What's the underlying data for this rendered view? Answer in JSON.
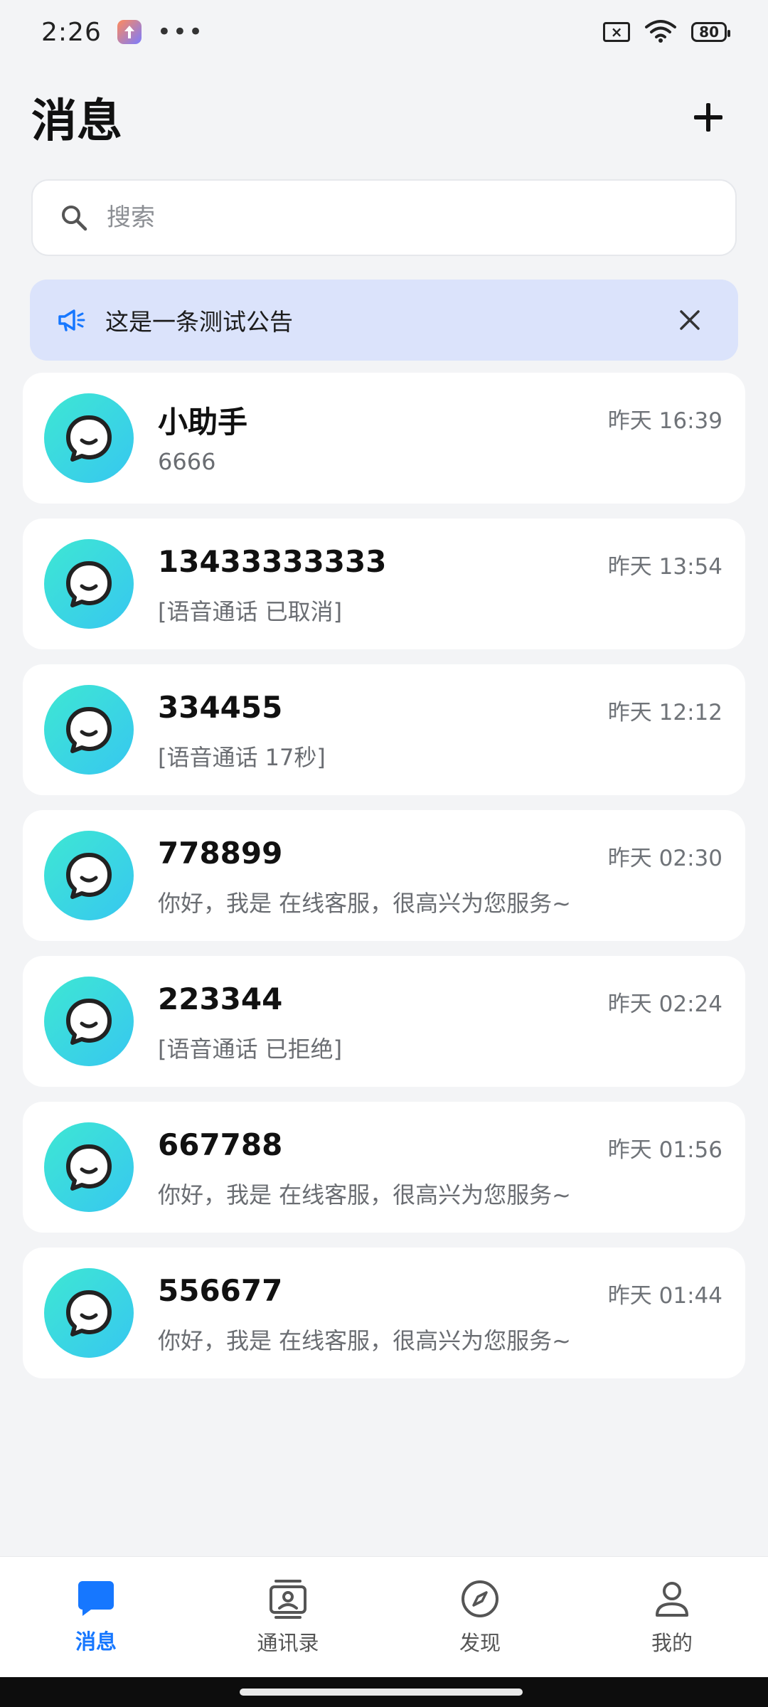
{
  "status_bar": {
    "time": "2:26",
    "battery": "80"
  },
  "header": {
    "title": "消息"
  },
  "search": {
    "placeholder": "搜索"
  },
  "notice": {
    "text": "这是一条测试公告"
  },
  "conversations": [
    {
      "name": "小助手",
      "time": "昨天 16:39",
      "preview": "6666"
    },
    {
      "name": "13433333333",
      "time": "昨天 13:54",
      "preview": "[语音通话 已取消]"
    },
    {
      "name": "334455",
      "time": "昨天 12:12",
      "preview": "[语音通话 17秒]"
    },
    {
      "name": "778899",
      "time": "昨天 02:30",
      "preview": "你好，我是 在线客服，很高兴为您服务~"
    },
    {
      "name": "223344",
      "time": "昨天 02:24",
      "preview": "[语音通话 已拒绝]"
    },
    {
      "name": "667788",
      "time": "昨天 01:56",
      "preview": "你好，我是 在线客服，很高兴为您服务~"
    },
    {
      "name": "556677",
      "time": "昨天 01:44",
      "preview": "你好，我是 在线客服，很高兴为您服务~"
    }
  ],
  "tabbar": {
    "tabs": [
      {
        "label": "消息",
        "icon": "chat-bubble-icon",
        "active": true
      },
      {
        "label": "通讯录",
        "icon": "contacts-icon",
        "active": false
      },
      {
        "label": "发现",
        "icon": "compass-icon",
        "active": false
      },
      {
        "label": "我的",
        "icon": "person-icon",
        "active": false
      }
    ]
  },
  "colors": {
    "accent": "#1677ff",
    "background": "#f3f4f6",
    "notice_bg": "#dbe3fb",
    "avatar_gradient_start": "#3ee7d3",
    "avatar_gradient_end": "#37c7f0"
  }
}
